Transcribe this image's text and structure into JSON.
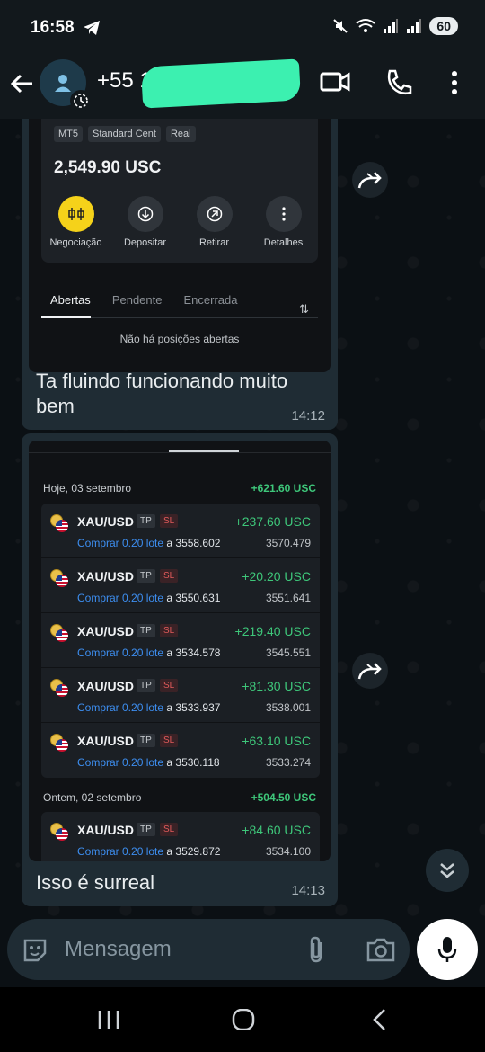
{
  "status": {
    "time": "16:58",
    "battery": "60"
  },
  "header": {
    "contact": "+55 1"
  },
  "msg1": {
    "tags": [
      "MT5",
      "Standard Cent",
      "Real"
    ],
    "balance": "2,549.90 USC",
    "actions": [
      "Negociação",
      "Depositar",
      "Retirar",
      "Detalhes"
    ],
    "tabs": [
      "Abertas",
      "Pendente",
      "Encerrada"
    ],
    "sort_icon": "⇅",
    "empty": "Não há posições abertas",
    "text": "Ta fluindo funcionando muito bem",
    "time": "14:12"
  },
  "msg2": {
    "day1": {
      "label": "Hoje, 03 setembro",
      "total": "+621.60 USC"
    },
    "day2": {
      "label": "Ontem, 02 setembro",
      "total": "+504.50 USC"
    },
    "trades_day1": [
      {
        "symbol": "XAU/USD",
        "tp": "TP",
        "sl": "SL",
        "pl": "+237.60 USC",
        "side": "Comprar 0.20 lote",
        "at": "a 3558.602",
        "current": "3570.479"
      },
      {
        "symbol": "XAU/USD",
        "tp": "TP",
        "sl": "SL",
        "pl": "+20.20 USC",
        "side": "Comprar 0.20 lote",
        "at": "a 3550.631",
        "current": "3551.641"
      },
      {
        "symbol": "XAU/USD",
        "tp": "TP",
        "sl": "SL",
        "pl": "+219.40 USC",
        "side": "Comprar 0.20 lote",
        "at": "a 3534.578",
        "current": "3545.551"
      },
      {
        "symbol": "XAU/USD",
        "tp": "TP",
        "sl": "SL",
        "pl": "+81.30 USC",
        "side": "Comprar 0.20 lote",
        "at": "a 3533.937",
        "current": "3538.001"
      },
      {
        "symbol": "XAU/USD",
        "tp": "TP",
        "sl": "SL",
        "pl": "+63.10 USC",
        "side": "Comprar 0.20 lote",
        "at": "a 3530.118",
        "current": "3533.274"
      }
    ],
    "trades_day2": [
      {
        "symbol": "XAU/USD",
        "tp": "TP",
        "sl": "SL",
        "pl": "+84.60 USC",
        "side": "Comprar 0.20 lote",
        "at": "a 3529.872",
        "current": "3534.100"
      }
    ],
    "text": "Isso é surreal",
    "time": "14:13"
  },
  "input": {
    "placeholder": "Mensagem"
  }
}
